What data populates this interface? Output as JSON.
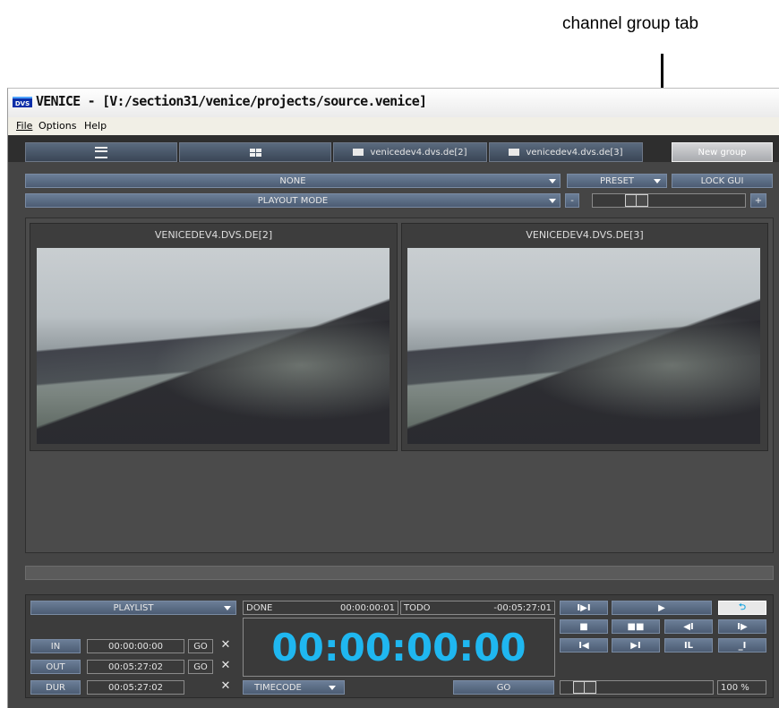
{
  "annotation": {
    "label": "channel group tab"
  },
  "window": {
    "logo_text": "DVS",
    "title": "VENICE - [V:/section31/venice/projects/source.venice]"
  },
  "menu": {
    "items": [
      "File",
      "Options",
      "Help"
    ]
  },
  "tabs": [
    {
      "label": "",
      "icon": "list-view-icon"
    },
    {
      "label": "",
      "icon": "grid-view-icon"
    },
    {
      "label": "venicedev4.dvs.de[2]",
      "icon": "monitor-icon"
    },
    {
      "label": "venicedev4.dvs.de[3]",
      "icon": "monitor-icon"
    },
    {
      "label": "New group",
      "active": true
    }
  ],
  "toolbar": {
    "group_select": "NONE",
    "preset_select": "PRESET",
    "lock_gui": "LOCK GUI",
    "mode_select": "PLAYOUT MODE",
    "zoom_minus": "-",
    "zoom_plus": "+"
  },
  "viewers": [
    {
      "title": "VENICEDEV4.DVS.DE[2]"
    },
    {
      "title": "VENICEDEV4.DVS.DE[3]"
    }
  ],
  "controls": {
    "playlist_select": "PLAYLIST",
    "done_label": "DONE",
    "done_value": "00:00:00:01",
    "todo_label": "TODO",
    "todo_value": "-00:05:27:01",
    "in_label": "IN",
    "in_value": "00:00:00:00",
    "out_label": "OUT",
    "out_value": "00:05:27:02",
    "dur_label": "DUR",
    "dur_value": "00:05:27:02",
    "go_label": "GO",
    "clear_glyph": "✕",
    "timecode_display": "00:00:00:00",
    "timecode_select": "TIMECODE",
    "go_main": "GO",
    "zoom_percent": "100 %",
    "transport": {
      "row1": [
        "I▶I",
        "▶",
        "⮌"
      ],
      "row2": [
        "■",
        "■■",
        "◀I",
        "I▶"
      ],
      "row3": [
        "I◀",
        "▶I",
        "IL",
        "_I"
      ]
    }
  },
  "colors": {
    "timecode": "#1fb7f0",
    "panel": "#454545",
    "button": "#5a6b82"
  }
}
